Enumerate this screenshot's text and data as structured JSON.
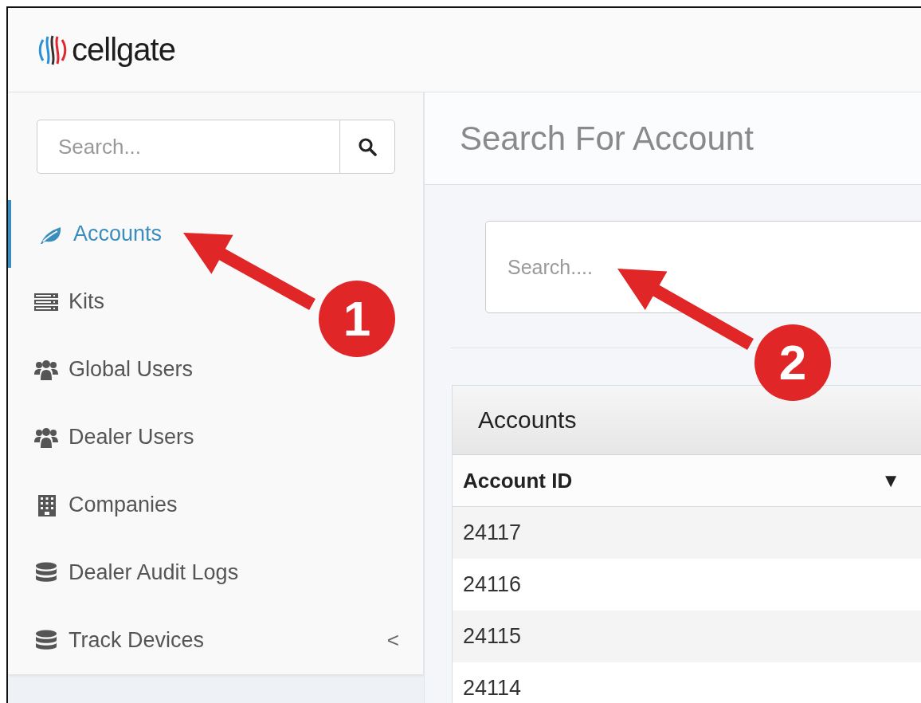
{
  "header": {
    "logo": "cellgate"
  },
  "sidebar": {
    "search": {
      "placeholder": "Search..."
    },
    "items": [
      {
        "label": "Accounts",
        "kind": "leaf",
        "selected": true
      },
      {
        "label": "Kits",
        "kind": "server",
        "selected": false
      },
      {
        "label": "Global Users",
        "kind": "users",
        "selected": false
      },
      {
        "label": "Dealer Users",
        "kind": "users",
        "selected": false
      },
      {
        "label": "Companies",
        "kind": "building",
        "selected": false
      },
      {
        "label": "Dealer Audit Logs",
        "kind": "database",
        "selected": false
      },
      {
        "label": "Track Devices",
        "kind": "database",
        "selected": false,
        "caret": "<"
      }
    ]
  },
  "main": {
    "title": "Search For Account",
    "search": {
      "placeholder": "Search...."
    },
    "panel": {
      "title": "Accounts",
      "table": {
        "columns": [
          {
            "label": "Account ID",
            "sort": "▼"
          }
        ],
        "rows": [
          [
            "24117"
          ],
          [
            "24116"
          ],
          [
            "24115"
          ],
          [
            "24114"
          ]
        ]
      }
    }
  },
  "callouts": [
    {
      "number": "1"
    },
    {
      "number": "2"
    }
  ]
}
